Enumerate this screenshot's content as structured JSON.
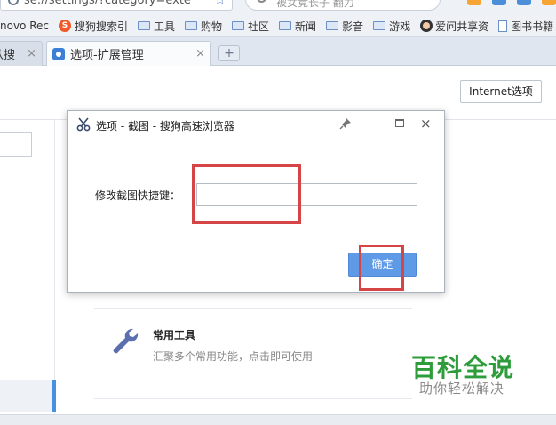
{
  "browser": {
    "address": {
      "text": "se://settings/?category=exte"
    },
    "search": {
      "placeholder": "被女竟长子  翻力"
    },
    "bookmarks": [
      {
        "label": "novo Rec",
        "icon": "none"
      },
      {
        "label": "搜狗搜索引",
        "icon": "sogou-icon"
      },
      {
        "label": "工具",
        "icon": "folder-icon"
      },
      {
        "label": "购物",
        "icon": "folder-icon"
      },
      {
        "label": "社区",
        "icon": "folder-icon"
      },
      {
        "label": "新闻",
        "icon": "folder-icon"
      },
      {
        "label": "影音",
        "icon": "folder-icon"
      },
      {
        "label": "游戏",
        "icon": "folder-icon"
      },
      {
        "label": "爱问共享资",
        "icon": "avatar-icon"
      },
      {
        "label": "图书书籍",
        "icon": "document-icon"
      }
    ],
    "tabs": [
      {
        "label": "从搜",
        "close": "×"
      },
      {
        "label": "选项-扩展管理",
        "close": "×"
      }
    ],
    "new_tab": "+"
  },
  "page": {
    "internet_options_label": "Internet选项",
    "tool": {
      "title": "常用工具",
      "description": "汇聚多个常用功能，点击即可使用",
      "icon": "wrench-icon"
    }
  },
  "dialog": {
    "title": "选项 - 截图 - 搜狗高速浏览器",
    "label": "修改截图快捷键：",
    "input_value": "",
    "ok_label": "确定",
    "close_glyph": "×"
  },
  "watermark": {
    "main": "百科全说",
    "sub": "助你轻松解决"
  },
  "colors": {
    "accent": "#5f9ae6",
    "annotation_red": "#d64545",
    "watermark_green": "#2e9c3a"
  }
}
